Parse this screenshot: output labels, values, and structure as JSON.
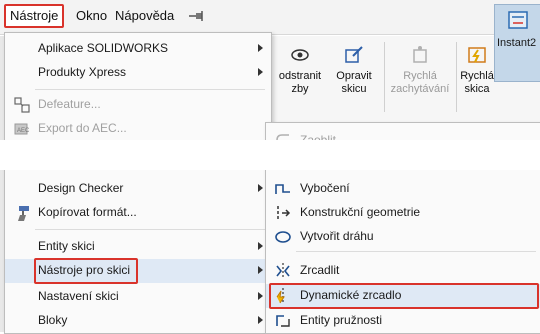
{
  "menubar": {
    "items": [
      {
        "label": "Nástroje"
      },
      {
        "label": "Okno"
      },
      {
        "label": "Nápověda"
      }
    ]
  },
  "ribbon": {
    "buttons": [
      {
        "label": "odstranit\nzby",
        "icon": "eye-icon"
      },
      {
        "label": "Opravit\nskicu",
        "icon": "repair-sketch-icon"
      },
      {
        "label": "Rychlá\nzachytávání",
        "icon": "quick-snap-icon"
      },
      {
        "label": "Rychlá\nskica",
        "icon": "rapid-sketch-icon"
      },
      {
        "label": "Instant2",
        "icon": "instant2d-icon"
      }
    ]
  },
  "menu": {
    "items": [
      {
        "label": "Aplikace SOLIDWORKS",
        "submenu": true,
        "disabled": false
      },
      {
        "label": "Produkty Xpress",
        "submenu": true,
        "disabled": false
      },
      {
        "label": "Defeature...",
        "submenu": false,
        "disabled": true
      },
      {
        "label": "Export do AEC...",
        "submenu": false,
        "disabled": true
      },
      {
        "label": "Design Checker",
        "submenu": true,
        "disabled": false
      },
      {
        "label": "Kopírovat formát...",
        "submenu": false,
        "disabled": false
      },
      {
        "label": "Entity skici",
        "submenu": true,
        "disabled": false
      },
      {
        "label": "Nástroje pro skici",
        "submenu": true,
        "disabled": false
      },
      {
        "label": "Nastavení skici",
        "submenu": true,
        "disabled": false
      },
      {
        "label": "Bloky",
        "submenu": true,
        "disabled": false
      }
    ]
  },
  "submenu": {
    "items": [
      {
        "label": "Zaoblit...",
        "disabled": true
      },
      {
        "label": "Vybočení",
        "disabled": false
      },
      {
        "label": "Konstrukční geometrie",
        "disabled": false
      },
      {
        "label": "Vytvořit dráhu",
        "disabled": false
      },
      {
        "label": "Zrcadlit",
        "disabled": false
      },
      {
        "label": "Dynamické zrcadlo",
        "disabled": false
      },
      {
        "label": "Entity pružnosti",
        "disabled": false
      }
    ]
  },
  "colors": {
    "highlight_border": "#d9332b",
    "menu_bg": "#fafafa",
    "disabled_text": "#a0a0a0"
  }
}
